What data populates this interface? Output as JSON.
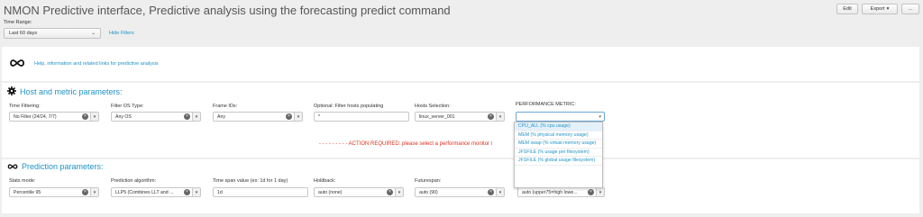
{
  "header": {
    "title": "NMON Predictive interface, Predictive analysis using the forecasting predict command",
    "edit_label": "Edit",
    "export_label": "Export",
    "more_label": "..."
  },
  "time_range": {
    "label": "Time Range:",
    "value": "Last 60 days",
    "hide_filters": "Hide Filters"
  },
  "help": {
    "text": "Help, information and related links for predictive analysis"
  },
  "host_section": {
    "title": "Host and metric parameters:",
    "fields": [
      {
        "label": "Time Filtering:",
        "value": "No Filter (24/24, 7/7)"
      },
      {
        "label": "Filter OS Type:",
        "value": "Any OS"
      },
      {
        "label": "Frame IDs:",
        "value": "Any"
      },
      {
        "label": "Optional: Filter hosts populating",
        "value": "*"
      },
      {
        "label": "Hosts Selection:",
        "value": "linux_server_001"
      },
      {
        "label": "PERFORMANCE METRIC:",
        "value": ""
      }
    ],
    "action_required": "- - - - - - - - - ACTION REQUIRED: please select a performance monitor i"
  },
  "metric_options": [
    "CPU_ALL (% cpu usage)",
    "MEM (% physical memory usage)",
    "MEM swap (% virtual memory usage)",
    "JFSFILE (% usage per filesystem)",
    "JFSFILE (% global usage filesystem)"
  ],
  "prediction_section": {
    "title": "Prediction parameters:",
    "fields": [
      {
        "label": "Stats mode:",
        "value": "Percentile 95"
      },
      {
        "label": "Prediction algorithm:",
        "value": "LLP5 (Combines LLT and ..."
      },
      {
        "label": "Time span value (ex: 1d for 1 day)",
        "value": "1d"
      },
      {
        "label": "Holdback:",
        "value": "auto (none)"
      },
      {
        "label": "Futurespan:",
        "value": "auto (90)"
      },
      {
        "label": "",
        "value": "auto (upper75=high lowe..."
      }
    ]
  },
  "icons": {
    "help": "infinity-icon",
    "host_section": "gear-icon",
    "prediction_section": "infinity-icon"
  }
}
